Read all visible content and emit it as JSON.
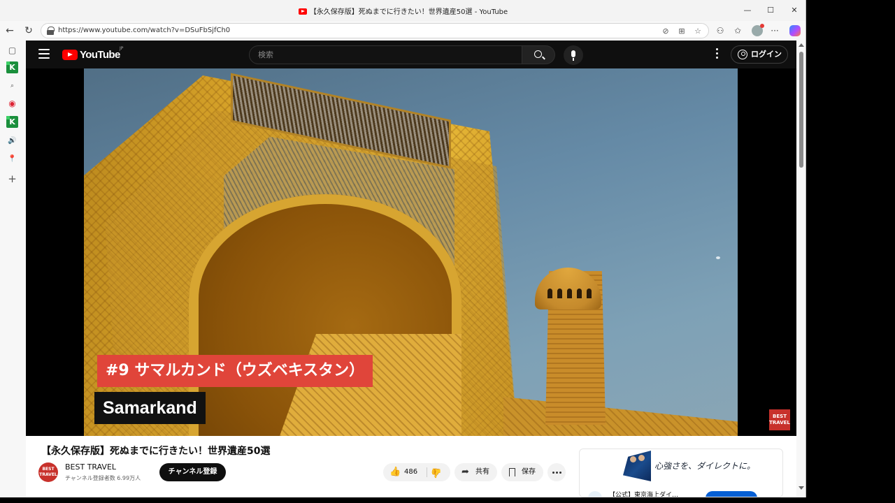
{
  "browser": {
    "tab_title": "【永久保存版】死ぬまでに行きたい！世界遺産50選 - YouTube",
    "url": "https://www.youtube.com/watch?v=DSuFbSjfCh0",
    "window_controls": {
      "minimize": "—",
      "maximize": "☐",
      "close": "✕"
    },
    "nav": {
      "back": "←",
      "refresh": "↻"
    },
    "bar_icons": {
      "reader": "⊘",
      "grid": "⊞",
      "star": "☆",
      "extensions": "⚇",
      "favorites": "✩",
      "menu": "···"
    },
    "sidebar_icons": {
      "tab": "▢",
      "k1": "K",
      "search": "⌕",
      "mail": "◉",
      "k2": "K",
      "audio": "🔊",
      "location": "📍",
      "add": "+"
    }
  },
  "youtube": {
    "logo_text": "YouTube",
    "region": "JP",
    "search": {
      "placeholder": "検索"
    },
    "login_label": "ログイン"
  },
  "video": {
    "caption_ja": "#9 サマルカンド（ウズベキスタン）",
    "caption_en": "Samarkand",
    "watermark": "BEST TRAVEL",
    "title": "【永久保存版】死ぬまでに行きたい！世界遺産50選",
    "channel": {
      "name": "BEST TRAVEL",
      "avatar_text": "BEST TRAVEL",
      "subscribers": "チャンネル登録者数 6.99万人",
      "subscribe_label": "チャンネル登録"
    },
    "actions": {
      "like_count": "486",
      "like_icon": "👍",
      "share_label": "共有",
      "share_icon": "➦",
      "save_label": "保存"
    }
  },
  "ad": {
    "headline": "心強さを、ダイレクトに。",
    "sub_text": "【公式】東京海上ダイ…"
  },
  "colors": {
    "youtube_red": "#ff0000",
    "caption_red": "#e0453a",
    "subscribe_black": "#0f0f0f",
    "ad_cta_blue": "#065fd4"
  }
}
